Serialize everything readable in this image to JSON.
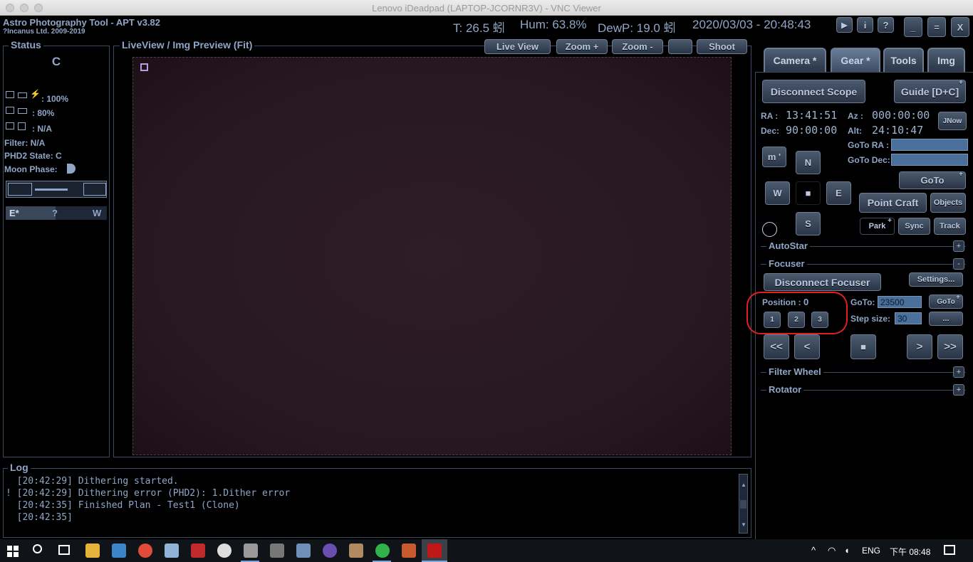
{
  "window_title": "Lenovo iDeadpad (LAPTOP-JCORNR3V) - VNC Viewer",
  "app": {
    "name": "Astro Photography Tool  -  APT v3.82",
    "copyright": "?Incanus Ltd. 2009-2019",
    "temp": "T: 26.5 蚓",
    "hum": "Hum: 63.8%",
    "dewp": "DewP: 19.0 蚓",
    "datetime": "2020/03/03 - 20:48:43",
    "top_buttons": [
      "▶",
      "i",
      "?",
      "_",
      "=",
      "X"
    ]
  },
  "status": {
    "title": "Status",
    "camera_letter": "C",
    "row1_value": ": 100%",
    "row2_value": ": 80%",
    "row3_value": ": N/A",
    "filter": "Filter: N/A",
    "phd2": "PHD2 State: C",
    "moon": "Moon Phase:",
    "pier_e": "E*",
    "pier_q": "?",
    "pier_w": "W"
  },
  "liveview": {
    "title": "LiveView / Img Preview (Fit)",
    "buttons": [
      "Live View",
      "Zoom +",
      "Zoom -",
      "",
      "Shoot"
    ]
  },
  "tabs": [
    "Camera *",
    "Gear *",
    "Tools",
    "Img"
  ],
  "gear": {
    "disconnect_scope": "Disconnect Scope",
    "guide": "Guide [D+C]",
    "ra_label": "RA :",
    "ra_value": "13:41:51",
    "dec_label": "Dec:",
    "dec_value": "90:00:00",
    "az_label": "Az :",
    "az_value": "000:00:00",
    "alt_label": "Alt:",
    "alt_value": "24:10:47",
    "jnow": "JNow",
    "goto_ra_label": "GoTo RA :",
    "goto_dec_label": "GoTo Dec:",
    "goto": "GoTo",
    "m_button": "m '",
    "n": "N",
    "w": "W",
    "stop": "■",
    "e": "E",
    "s": "S",
    "point_craft": "Point Craft",
    "objects": "Objects",
    "park": "Park",
    "sync": "Sync",
    "track": "Track",
    "autostar": "AutoStar",
    "focuser": "Focuser",
    "disconnect_focuser": "Disconnect Focuser",
    "settings": "Settings...",
    "position_label": "Position :",
    "position_value": "0",
    "goto_label": "GoTo:",
    "goto_value": "23500",
    "goto_small": "GoTo",
    "step_label": "Step size:",
    "step_value": "30",
    "more": "...",
    "preset1": "1",
    "preset2": "2",
    "preset3": "3",
    "ff_left": "<<",
    "f_left": "<",
    "f_stop": "■",
    "f_right": ">",
    "ff_right": ">>",
    "filter_wheel": "Filter Wheel",
    "rotator": "Rotator",
    "plus": "+",
    "minus": "-"
  },
  "log": {
    "title": "Log",
    "lines": [
      "  [20:42:29] Dithering started.",
      "! [20:42:29] Dithering error (PHD2): 1.Dither error",
      "  [20:42:35] Finished Plan - Test1 (Clone)",
      "  [20:42:35]"
    ]
  },
  "taskbar": {
    "lang": "ENG",
    "time": "下午 08:48"
  },
  "colors": {
    "accent": "#8fa6c6",
    "button": "#3a475a",
    "preview": "#2a1a22",
    "highlight": "#e02020"
  }
}
